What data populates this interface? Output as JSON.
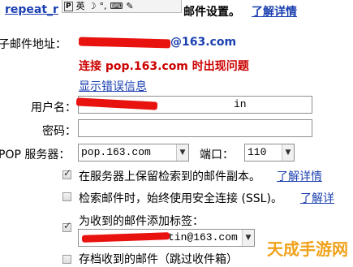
{
  "top": {
    "prefix": "repeat_r",
    "suffix": "邮件设置。",
    "link": "了解详情"
  },
  "ime_toolbar": {
    "mode_label": "P",
    "lang_label": "英",
    "icons": [
      "moon-icon",
      "punct-icon",
      "keyboard-icon",
      "settings-icon"
    ]
  },
  "account": {
    "label": "子邮件地址：",
    "address_visible": "@163.com",
    "error_message": "连接 pop.163.com 时出现问题",
    "show_error_link": "显示错误信息"
  },
  "form": {
    "username_label": "用户名：",
    "username_visible_end": "in",
    "password_label": "密码：",
    "server_label": "POP 服务器：",
    "server_value": "pop.163.com",
    "port_label": "端口：",
    "port_value": "110"
  },
  "options": [
    {
      "checked": true,
      "text": "在服务器上保留检索到的邮件副本。",
      "link": "了解详情"
    },
    {
      "checked": false,
      "text": "检索邮件时，始终使用安全连接 (SSL)。",
      "link": "了解详"
    },
    {
      "checked": true,
      "text": "为收到的邮件添加标签：",
      "link": ""
    },
    {
      "checked": false,
      "text": "存档收到的邮件（跳过收件箱）",
      "link": ""
    }
  ],
  "label_select_visible": "tin@163.com",
  "watermark": "天成手游网",
  "colors": {
    "link": "#1a3fb0",
    "error": "#cc0000",
    "redact": "#e8130f"
  }
}
